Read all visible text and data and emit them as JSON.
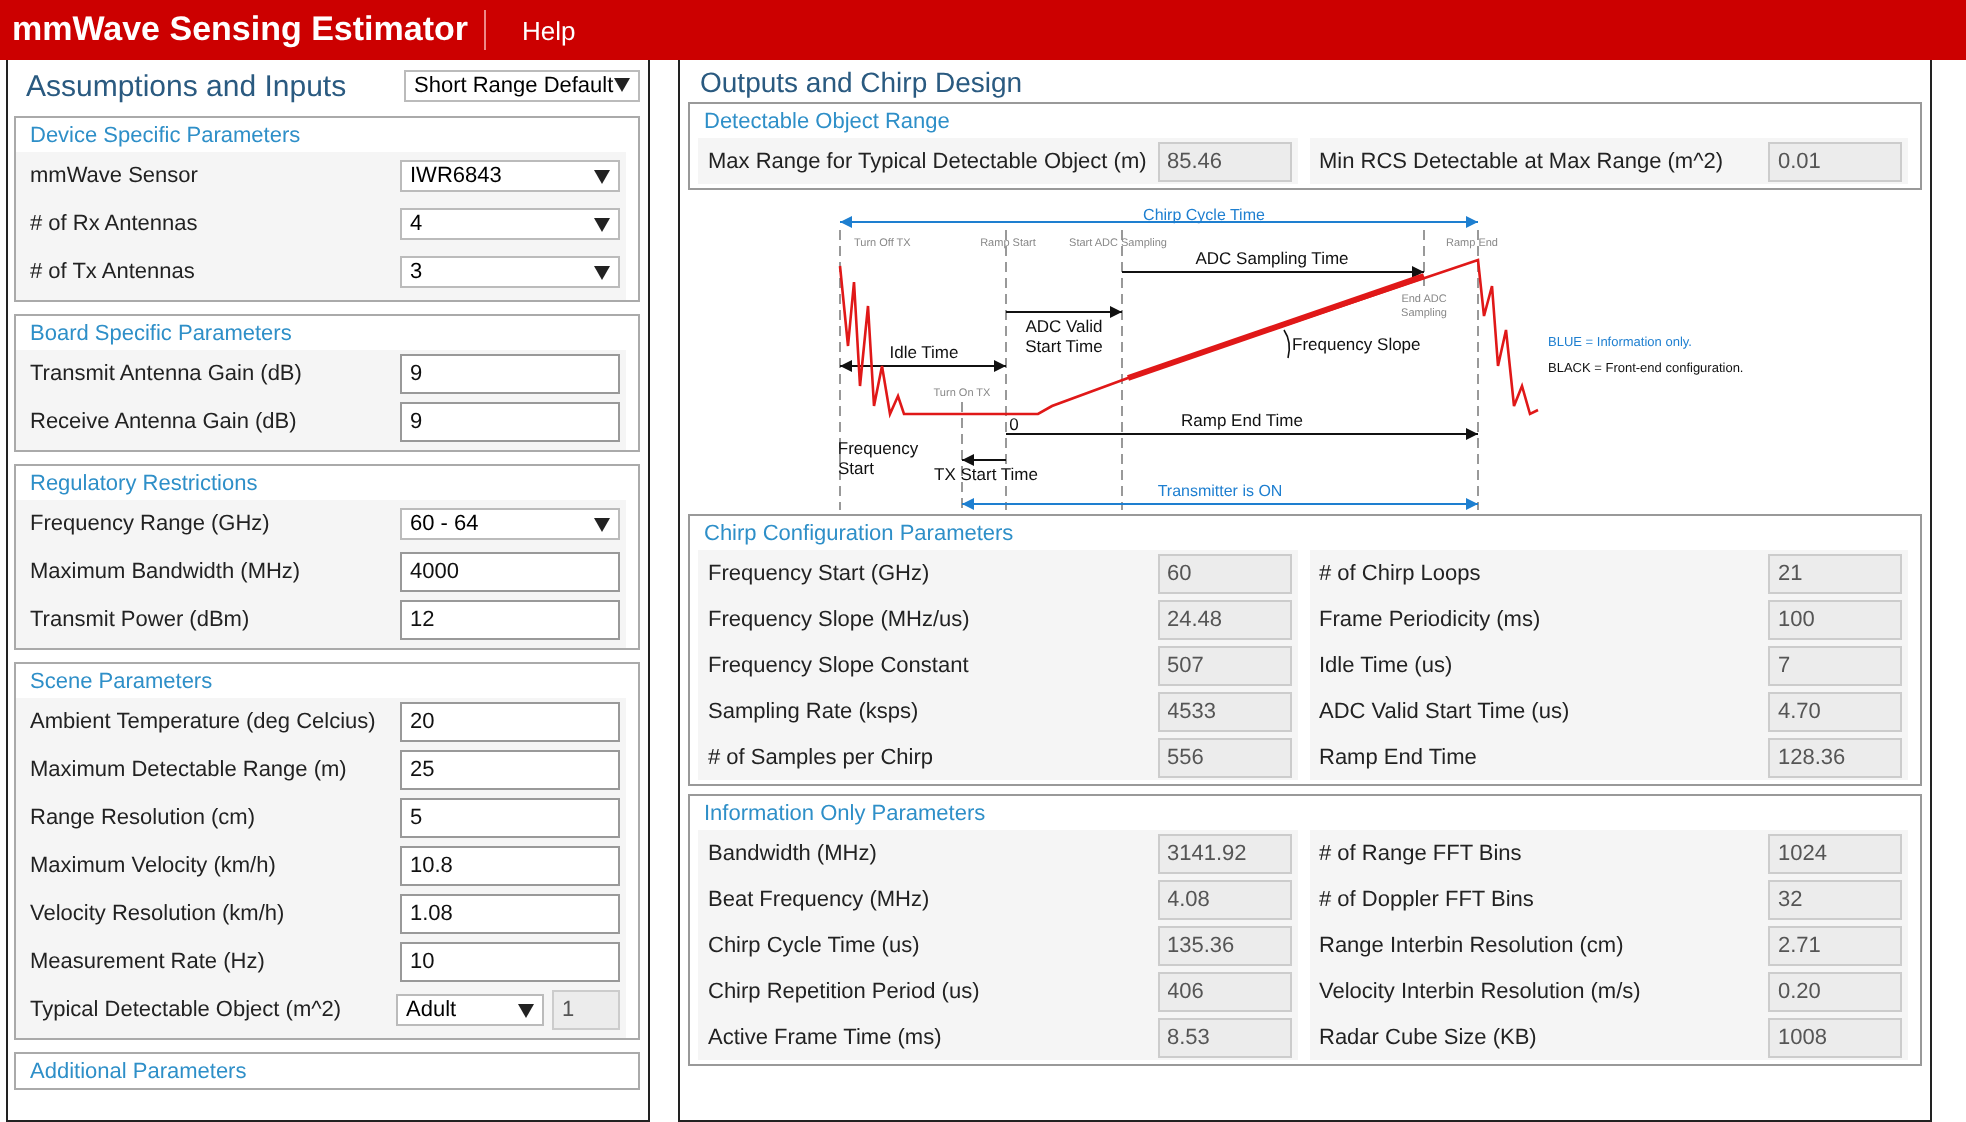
{
  "header": {
    "title": "mmWave Sensing Estimator",
    "menu": [
      {
        "label": "Help"
      }
    ]
  },
  "inputs": {
    "title": "Assumptions and Inputs",
    "preset": "Short Range Default",
    "sections": [
      {
        "title": "Device Specific Parameters",
        "rows": [
          {
            "label": "mmWave Sensor",
            "kind": "select",
            "value": "IWR6843"
          },
          {
            "label": "# of Rx Antennas",
            "kind": "select",
            "value": "4"
          },
          {
            "label": "# of Tx Antennas",
            "kind": "select",
            "value": "3"
          }
        ]
      },
      {
        "title": "Board Specific Parameters",
        "rows": [
          {
            "label": "Transmit Antenna Gain (dB)",
            "kind": "input",
            "value": "9"
          },
          {
            "label": "Receive Antenna Gain (dB)",
            "kind": "input",
            "value": "9"
          }
        ]
      },
      {
        "title": "Regulatory Restrictions",
        "rows": [
          {
            "label": "Frequency Range (GHz)",
            "kind": "select",
            "value": "60 - 64"
          },
          {
            "label": "Maximum Bandwidth (MHz)",
            "kind": "input",
            "value": "4000"
          },
          {
            "label": "Transmit Power (dBm)",
            "kind": "input",
            "value": "12"
          }
        ]
      },
      {
        "title": "Scene Parameters",
        "rows": [
          {
            "label": "Ambient Temperature (deg Celcius)",
            "kind": "input",
            "value": "20"
          },
          {
            "label": "Maximum Detectable Range (m)",
            "kind": "input",
            "value": "25"
          },
          {
            "label": "Range Resolution (cm)",
            "kind": "input",
            "value": "5"
          },
          {
            "label": "Maximum Velocity (km/h)",
            "kind": "input",
            "value": "10.8"
          },
          {
            "label": "Velocity Resolution (km/h)",
            "kind": "input",
            "value": "1.08"
          },
          {
            "label": "Measurement Rate (Hz)",
            "kind": "input",
            "value": "10"
          },
          {
            "label": "Typical Detectable Object (m^2)",
            "kind": "select_with_value",
            "value": "Adult",
            "extra_value": "1"
          }
        ]
      },
      {
        "title": "Additional Parameters"
      }
    ]
  },
  "outputs": {
    "title": "Outputs and Chirp Design",
    "detectable": {
      "title": "Detectable Object Range",
      "fields": [
        {
          "label": "Max Range for Typical Detectable Object (m)",
          "value": "85.46"
        },
        {
          "label": "Min RCS Detectable at Max Range (m^2)",
          "value": "0.01"
        }
      ]
    },
    "diagram": {
      "chirp_cycle_time": "Chirp Cycle Time",
      "turn_off_tx": "Turn Off TX",
      "ramp_start": "Ramp Start",
      "start_adc_sampling": "Start ADC Sampling",
      "ramp_end": "Ramp End",
      "adc_sampling_time": "ADC Sampling Time",
      "end_adc_sampling": [
        "End ADC",
        "Sampling"
      ],
      "adc_valid_start_time": [
        "ADC Valid",
        "Start Time"
      ],
      "idle_time": "Idle Time",
      "frequency_slope": "Frequency Slope",
      "turn_on_tx": "Turn On TX",
      "zero": "0",
      "ramp_end_time": "Ramp End Time",
      "frequency_start": [
        "Frequency",
        "Start"
      ],
      "tx_start_time": "TX Start Time",
      "transmitter_on": "Transmitter is ON",
      "legend_info": "BLUE = Information only.",
      "legend_config": "BLACK = Front-end configuration."
    },
    "chirp_config": {
      "title": "Chirp Configuration Parameters",
      "left": [
        {
          "label": "Frequency Start (GHz)",
          "value": "60"
        },
        {
          "label": "Frequency Slope (MHz/us)",
          "value": "24.48"
        },
        {
          "label": "Frequency Slope Constant",
          "value": "507"
        },
        {
          "label": "Sampling Rate (ksps)",
          "value": "4533"
        },
        {
          "label": "# of Samples per Chirp",
          "value": "556"
        }
      ],
      "right": [
        {
          "label": "# of Chirp Loops",
          "value": "21"
        },
        {
          "label": "Frame Periodicity (ms)",
          "value": "100"
        },
        {
          "label": "Idle Time (us)",
          "value": "7"
        },
        {
          "label": "ADC Valid Start Time (us)",
          "value": "4.70"
        },
        {
          "label": "Ramp End Time",
          "value": "128.36"
        }
      ]
    },
    "info": {
      "title": "Information Only Parameters",
      "left": [
        {
          "label": "Bandwidth (MHz)",
          "value": "3141.92"
        },
        {
          "label": "Beat Frequency (MHz)",
          "value": "4.08"
        },
        {
          "label": "Chirp Cycle Time (us)",
          "value": "135.36"
        },
        {
          "label": "Chirp Repetition Period (us)",
          "value": "406"
        },
        {
          "label": "Active Frame Time (ms)",
          "value": "8.53"
        }
      ],
      "right": [
        {
          "label": "# of Range FFT Bins",
          "value": "1024"
        },
        {
          "label": "# of Doppler FFT Bins",
          "value": "32"
        },
        {
          "label": "Range Interbin Resolution (cm)",
          "value": "2.71"
        },
        {
          "label": "Velocity Interbin Resolution (m/s)",
          "value": "0.20"
        },
        {
          "label": "Radar Cube Size (KB)",
          "value": "1008"
        }
      ]
    }
  }
}
